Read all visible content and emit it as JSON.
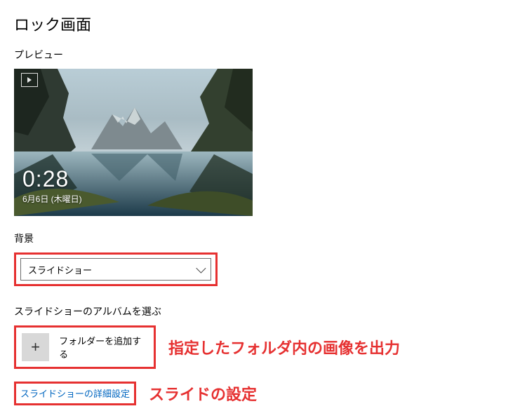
{
  "page_title": "ロック画面",
  "preview": {
    "label": "プレビュー",
    "time": "0:28",
    "date": "6月6日 (木曜日)"
  },
  "background": {
    "label": "背景",
    "selected": "スライドショー"
  },
  "album": {
    "label": "スライドショーのアルバムを選ぶ",
    "add_label": "フォルダーを追加する",
    "annotation": "指定したフォルダ内の画像を出力"
  },
  "advanced": {
    "link": "スライドショーの詳細設定",
    "annotation": "スライドの設定"
  }
}
